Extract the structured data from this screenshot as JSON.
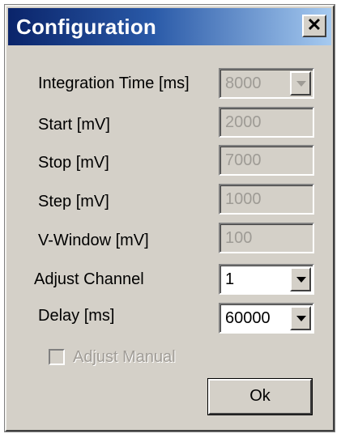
{
  "window": {
    "title": "Configuration",
    "close_glyph": "✕"
  },
  "fields": [
    {
      "label": "Integration Time [ms]",
      "value": "8000",
      "type": "dropdown",
      "enabled": false
    },
    {
      "label": "Start [mV]",
      "value": "2000",
      "type": "text",
      "enabled": false
    },
    {
      "label": "Stop [mV]",
      "value": "7000",
      "type": "text",
      "enabled": false
    },
    {
      "label": "Step [mV]",
      "value": "1000",
      "type": "text",
      "enabled": false
    },
    {
      "label": "V-Window [mV]",
      "value": "100",
      "type": "text",
      "enabled": false
    },
    {
      "label": "Adjust Channel",
      "value": "1",
      "type": "dropdown",
      "enabled": true
    },
    {
      "label": "Delay [ms]",
      "value": "60000",
      "type": "dropdown",
      "enabled": true
    }
  ],
  "adjust_manual": {
    "label": "Adjust Manual",
    "checked": false,
    "enabled": false
  },
  "ok_button": {
    "label": "Ok"
  },
  "icons": {
    "close": "close-icon",
    "dropdown": "chevron-down-icon"
  },
  "colors": {
    "title_gradient_start": "#0a246a",
    "title_gradient_end": "#a6caf0",
    "dialog_face": "#d4d0c8",
    "disabled_text": "#9e9b95"
  }
}
